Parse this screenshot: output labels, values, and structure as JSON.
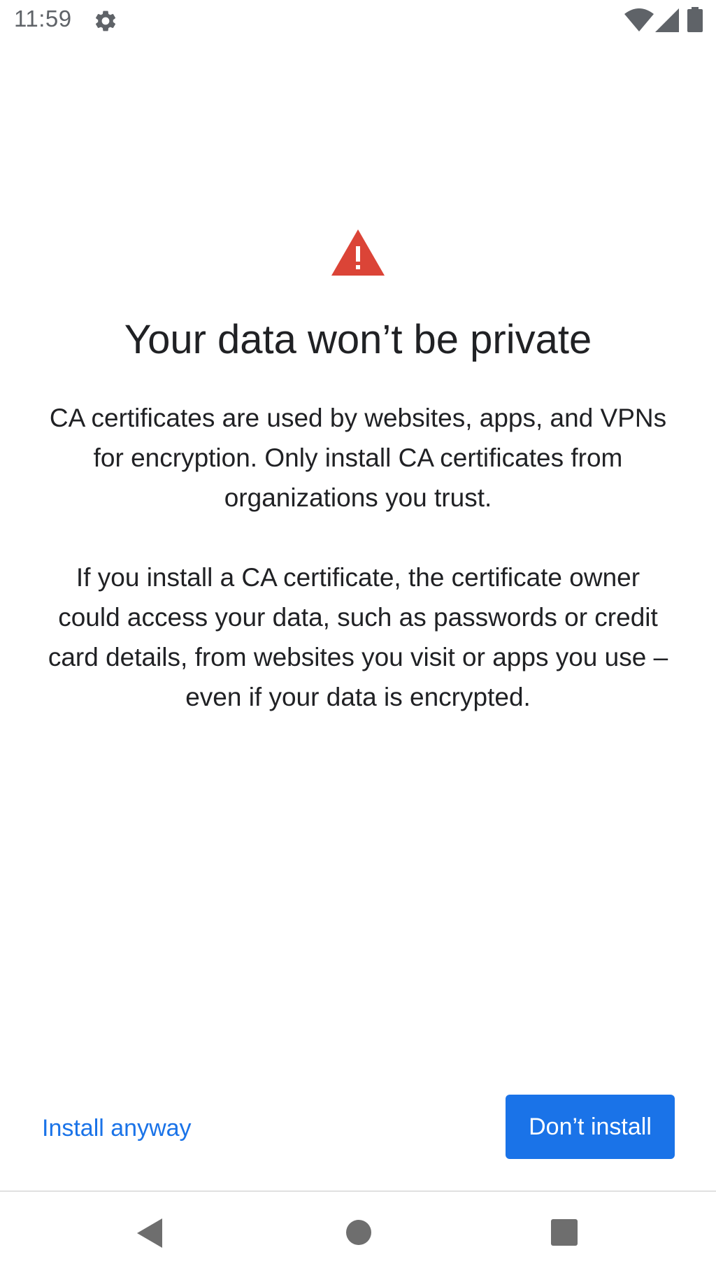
{
  "status_bar": {
    "time": "11:59",
    "icons": [
      "gear-icon",
      "wifi-icon",
      "signal-icon",
      "battery-icon"
    ]
  },
  "dialog": {
    "icon": "warning-icon",
    "title": "Your data won’t be private",
    "paragraph_1": "CA certificates are used by websites, apps, and VPNs for encryption. Only install CA certificates from organizations you trust.",
    "paragraph_2": "If you install a CA certificate, the certificate owner could access your data, such as passwords or credit card details, from websites you visit or apps you use – even if your data is encrypted."
  },
  "actions": {
    "install_anyway": "Install anyway",
    "dont_install": "Don’t install"
  },
  "nav_bar": {
    "icons": [
      "back-icon",
      "home-icon",
      "recents-icon"
    ]
  },
  "colors": {
    "accent": "#1a73e8",
    "warning": "#db4437",
    "text_primary": "#202124",
    "status_icons": "#5f6368",
    "nav_icons": "#6e6e6e"
  }
}
